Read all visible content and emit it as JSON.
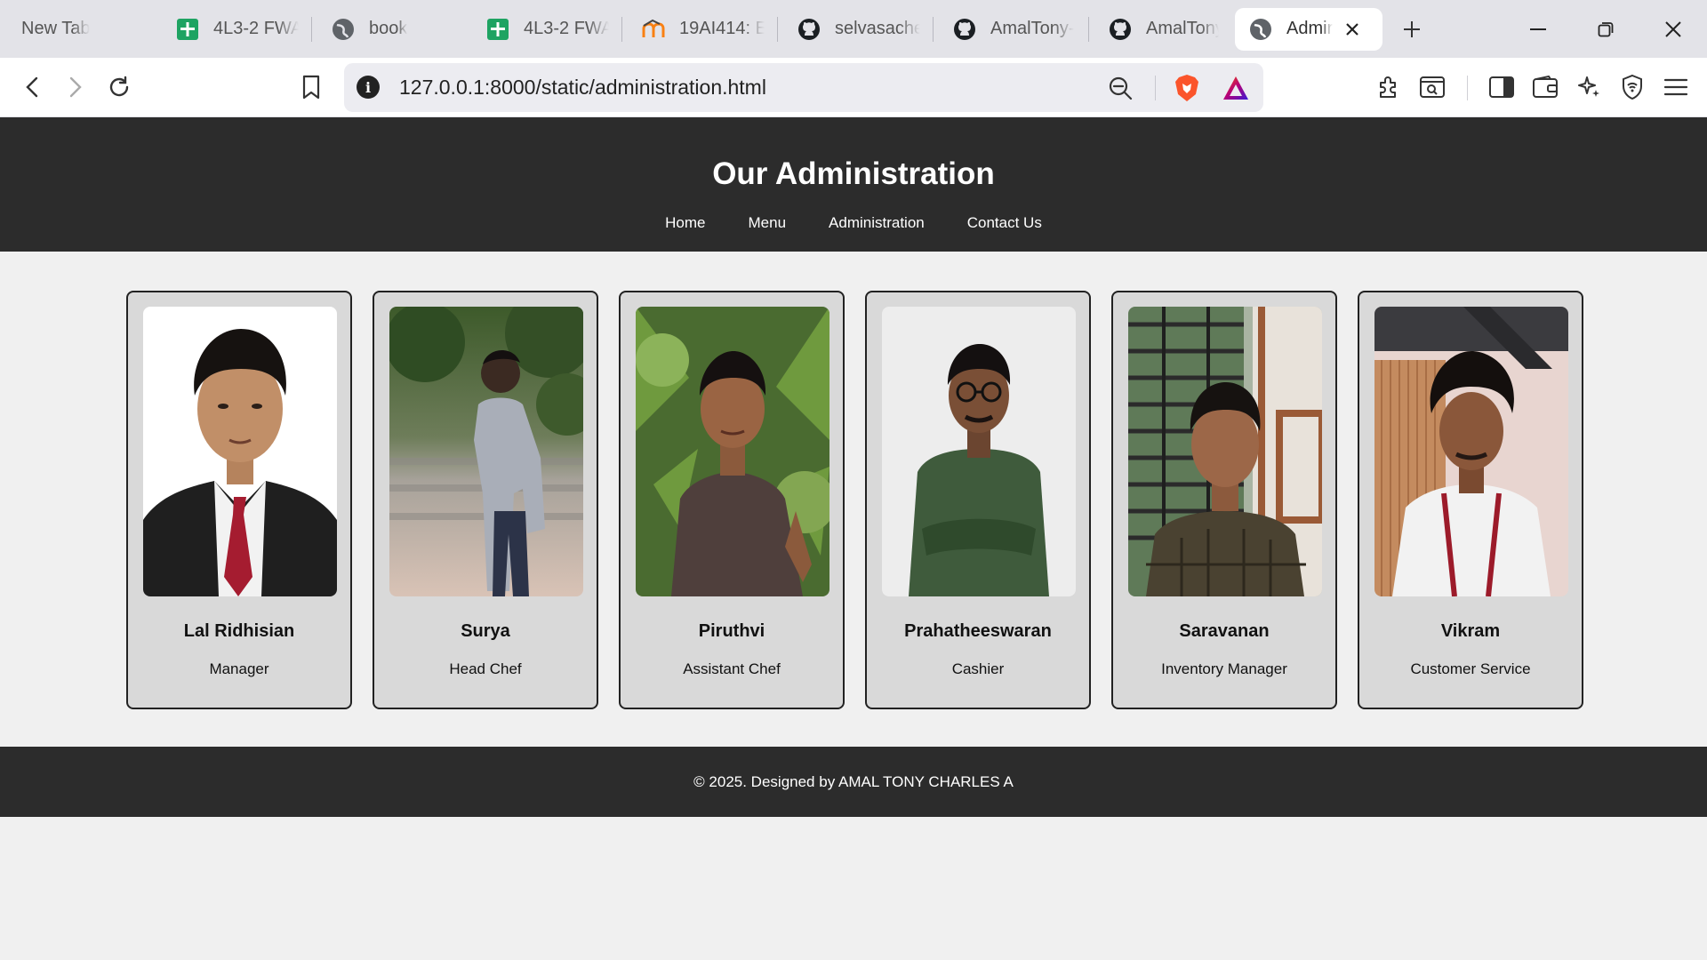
{
  "browser": {
    "tabs": [
      {
        "title": "New Tab",
        "icon": "none"
      },
      {
        "title": "4L3-2 FWA",
        "icon": "sheets-icon"
      },
      {
        "title": "book",
        "icon": "globe-icon"
      },
      {
        "title": "4L3-2 FWA",
        "icon": "sheets-icon"
      },
      {
        "title": "19AI414: E",
        "icon": "moodle-icon"
      },
      {
        "title": "selvasache",
        "icon": "github-icon"
      },
      {
        "title": "AmalTony-",
        "icon": "github-icon"
      },
      {
        "title": "AmalTony-",
        "icon": "github-icon"
      }
    ],
    "active_tab": {
      "title": "Admir",
      "icon": "globe-icon"
    },
    "url": "127.0.0.1:8000/static/administration.html"
  },
  "page": {
    "title": "Our Administration",
    "nav": [
      "Home",
      "Menu",
      "Administration",
      "Contact Us"
    ],
    "staff": [
      {
        "name": "Lal Ridhisian",
        "role": "Manager"
      },
      {
        "name": "Surya",
        "role": "Head Chef"
      },
      {
        "name": "Piruthvi",
        "role": "Assistant Chef"
      },
      {
        "name": "Prahatheeswaran",
        "role": "Cashier"
      },
      {
        "name": "Saravanan",
        "role": "Inventory Manager"
      },
      {
        "name": "Vikram",
        "role": "Customer Service"
      }
    ],
    "footer": "© 2025. Designed by AMAL TONY CHARLES A"
  },
  "colors": {
    "header_bg": "#2c2c2c",
    "page_bg": "#f0f0f0",
    "card_bg": "#d9d9d9",
    "brave_orange": "#fb542b"
  }
}
